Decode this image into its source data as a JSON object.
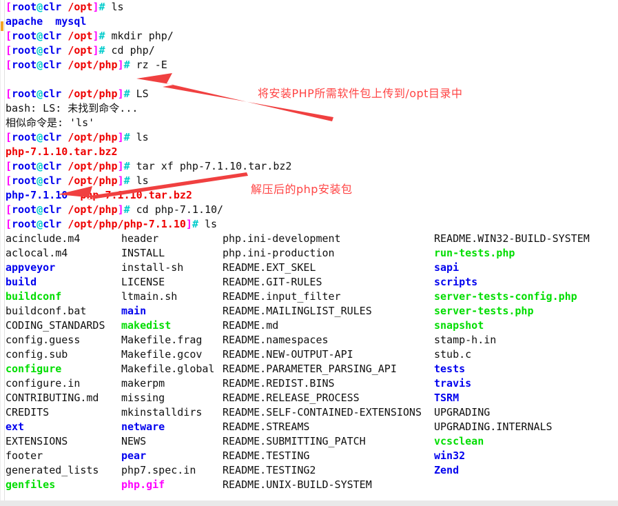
{
  "terminal": {
    "prompt": {
      "open_bracket": "[",
      "user": "root",
      "at": "@",
      "host": "clr",
      "space": " ",
      "close_bracket": "]",
      "hash": "#"
    },
    "lines": [
      {
        "type": "prompt",
        "cwd": "/opt",
        "command": " ls"
      },
      {
        "type": "output",
        "segments": [
          {
            "text": "apache",
            "color": "dir"
          },
          {
            "text": "  ",
            "color": "plain"
          },
          {
            "text": "mysql",
            "color": "dir"
          }
        ]
      },
      {
        "type": "prompt",
        "cwd": "/opt",
        "command": " mkdir php/"
      },
      {
        "type": "prompt",
        "cwd": "/opt",
        "command": " cd php/"
      },
      {
        "type": "prompt",
        "cwd": "/opt/php",
        "command": " rz -E"
      },
      {
        "type": "blank"
      },
      {
        "type": "prompt",
        "cwd": "/opt/php",
        "command": " LS"
      },
      {
        "type": "output",
        "segments": [
          {
            "text": "bash: LS: 未找到命令...",
            "color": "plain"
          }
        ]
      },
      {
        "type": "output",
        "segments": [
          {
            "text": "相似命令是: 'ls'",
            "color": "plain"
          }
        ]
      },
      {
        "type": "prompt",
        "cwd": "/opt/php",
        "command": " ls"
      },
      {
        "type": "output",
        "segments": [
          {
            "text": "php-7.1.10.tar.bz2",
            "color": "arch"
          }
        ]
      },
      {
        "type": "prompt",
        "cwd": "/opt/php",
        "command": " tar xf php-7.1.10.tar.bz2"
      },
      {
        "type": "prompt",
        "cwd": "/opt/php",
        "command": " ls"
      },
      {
        "type": "output",
        "segments": [
          {
            "text": "php-7.1.10",
            "color": "dir"
          },
          {
            "text": "  ",
            "color": "plain"
          },
          {
            "text": "php-7.1.10.tar.bz2",
            "color": "arch"
          }
        ]
      },
      {
        "type": "prompt",
        "cwd": "/opt/php",
        "command": " cd php-7.1.10/"
      },
      {
        "type": "prompt",
        "cwd": "/opt/php/php-7.1.10",
        "command": " ls"
      }
    ],
    "listing": {
      "columns": [
        [
          {
            "name": "acinclude.m4",
            "color": "plain"
          },
          {
            "name": "aclocal.m4",
            "color": "plain"
          },
          {
            "name": "appveyor",
            "color": "dir"
          },
          {
            "name": "build",
            "color": "dir"
          },
          {
            "name": "buildconf",
            "color": "exe"
          },
          {
            "name": "buildconf.bat",
            "color": "plain"
          },
          {
            "name": "CODING_STANDARDS",
            "color": "plain"
          },
          {
            "name": "config.guess",
            "color": "plain"
          },
          {
            "name": "config.sub",
            "color": "plain"
          },
          {
            "name": "configure",
            "color": "exe"
          },
          {
            "name": "configure.in",
            "color": "plain"
          },
          {
            "name": "CONTRIBUTING.md",
            "color": "plain"
          },
          {
            "name": "CREDITS",
            "color": "plain"
          },
          {
            "name": "ext",
            "color": "dir"
          },
          {
            "name": "EXTENSIONS",
            "color": "plain"
          },
          {
            "name": "footer",
            "color": "plain"
          },
          {
            "name": "generated_lists",
            "color": "plain"
          },
          {
            "name": "genfiles",
            "color": "exe"
          }
        ],
        [
          {
            "name": "header",
            "color": "plain"
          },
          {
            "name": "INSTALL",
            "color": "plain"
          },
          {
            "name": "install-sh",
            "color": "plain"
          },
          {
            "name": "LICENSE",
            "color": "plain"
          },
          {
            "name": "ltmain.sh",
            "color": "plain"
          },
          {
            "name": "main",
            "color": "dir"
          },
          {
            "name": "makedist",
            "color": "exe"
          },
          {
            "name": "Makefile.frag",
            "color": "plain"
          },
          {
            "name": "Makefile.gcov",
            "color": "plain"
          },
          {
            "name": "Makefile.global",
            "color": "plain"
          },
          {
            "name": "makerpm",
            "color": "plain"
          },
          {
            "name": "missing",
            "color": "plain"
          },
          {
            "name": "mkinstalldirs",
            "color": "plain"
          },
          {
            "name": "netware",
            "color": "dir"
          },
          {
            "name": "NEWS",
            "color": "plain"
          },
          {
            "name": "pear",
            "color": "dir"
          },
          {
            "name": "php7.spec.in",
            "color": "plain"
          },
          {
            "name": "php.gif",
            "color": "img"
          }
        ],
        [
          {
            "name": "php.ini-development",
            "color": "plain"
          },
          {
            "name": "php.ini-production",
            "color": "plain"
          },
          {
            "name": "README.EXT_SKEL",
            "color": "plain"
          },
          {
            "name": "README.GIT-RULES",
            "color": "plain"
          },
          {
            "name": "README.input_filter",
            "color": "plain"
          },
          {
            "name": "README.MAILINGLIST_RULES",
            "color": "plain"
          },
          {
            "name": "README.md",
            "color": "plain"
          },
          {
            "name": "README.namespaces",
            "color": "plain"
          },
          {
            "name": "README.NEW-OUTPUT-API",
            "color": "plain"
          },
          {
            "name": "README.PARAMETER_PARSING_API",
            "color": "plain"
          },
          {
            "name": "README.REDIST.BINS",
            "color": "plain"
          },
          {
            "name": "README.RELEASE_PROCESS",
            "color": "plain"
          },
          {
            "name": "README.SELF-CONTAINED-EXTENSIONS",
            "color": "plain"
          },
          {
            "name": "README.STREAMS",
            "color": "plain"
          },
          {
            "name": "README.SUBMITTING_PATCH",
            "color": "plain"
          },
          {
            "name": "README.TESTING",
            "color": "plain"
          },
          {
            "name": "README.TESTING2",
            "color": "plain"
          },
          {
            "name": "README.UNIX-BUILD-SYSTEM",
            "color": "plain"
          }
        ],
        [
          {
            "name": "README.WIN32-BUILD-SYSTEM",
            "color": "plain"
          },
          {
            "name": "run-tests.php",
            "color": "exe"
          },
          {
            "name": "sapi",
            "color": "dir"
          },
          {
            "name": "scripts",
            "color": "dir"
          },
          {
            "name": "server-tests-config.php",
            "color": "exe"
          },
          {
            "name": "server-tests.php",
            "color": "exe"
          },
          {
            "name": "snapshot",
            "color": "exe"
          },
          {
            "name": "stamp-h.in",
            "color": "plain"
          },
          {
            "name": "stub.c",
            "color": "plain"
          },
          {
            "name": "tests",
            "color": "dir"
          },
          {
            "name": "travis",
            "color": "dir"
          },
          {
            "name": "TSRM",
            "color": "dir"
          },
          {
            "name": "UPGRADING",
            "color": "plain"
          },
          {
            "name": "UPGRADING.INTERNALS",
            "color": "plain"
          },
          {
            "name": "vcsclean",
            "color": "exe"
          },
          {
            "name": "win32",
            "color": "dir"
          },
          {
            "name": "Zend",
            "color": "dir"
          }
        ]
      ]
    }
  },
  "annotations": {
    "upload_note": "将安装PHP所需软件包上传到/opt目录中",
    "extract_note": "解压后的php安装包",
    "arrow_color": "#f04040"
  },
  "colors": {
    "bracket": "#ff00ff",
    "user": "#0000ee",
    "at": "#00cccc",
    "path": "#ee0000",
    "hash": "#00cccc",
    "directory": "#0000ee",
    "executable": "#00dd00",
    "archive": "#ee0000",
    "image": "#ff00ff",
    "text": "#101010",
    "background": "#ffffff"
  }
}
